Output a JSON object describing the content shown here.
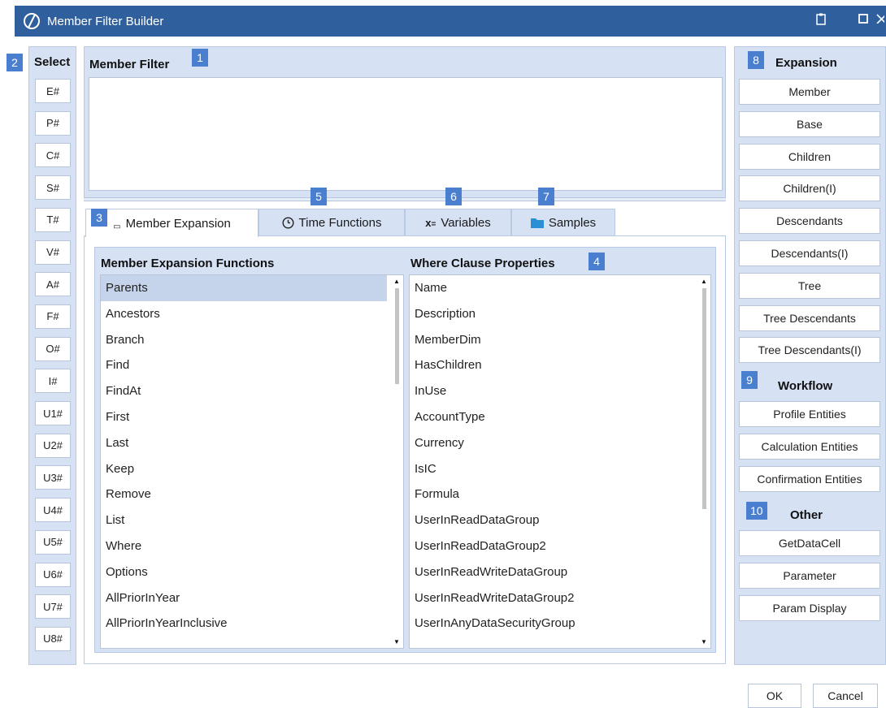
{
  "window": {
    "title": "Member Filter Builder"
  },
  "select": {
    "heading": "Select",
    "badge": "2",
    "buttons": [
      "E#",
      "P#",
      "C#",
      "S#",
      "T#",
      "V#",
      "A#",
      "F#",
      "O#",
      "I#",
      "U1#",
      "U2#",
      "U3#",
      "U4#",
      "U5#",
      "U6#",
      "U7#",
      "U8#"
    ]
  },
  "member_filter": {
    "heading": "Member Filter",
    "badge": "1",
    "value": ""
  },
  "tabs": [
    {
      "label": "Member Expansion",
      "badge": "3",
      "icon": "member-expansion-icon"
    },
    {
      "label": "Time Functions",
      "badge": "5",
      "icon": "clock-icon"
    },
    {
      "label": "Variables",
      "badge": "6",
      "icon": "variable-icon"
    },
    {
      "label": "Samples",
      "badge": "7",
      "icon": "folder-icon"
    }
  ],
  "functions": {
    "heading": "Member Expansion Functions",
    "selected": "Parents",
    "items": [
      "Parents",
      "Ancestors",
      "Branch",
      "Find",
      "FindAt",
      "First",
      "Last",
      "Keep",
      "Remove",
      "List",
      "Where",
      "Options",
      "AllPriorInYear",
      "AllPriorInYearInclusive"
    ]
  },
  "where_clause": {
    "heading": "Where Clause Properties",
    "badge": "4",
    "items": [
      "Name",
      "Description",
      "MemberDim",
      "HasChildren",
      "InUse",
      "AccountType",
      "Currency",
      "IsIC",
      "Formula",
      "UserInReadDataGroup",
      "UserInReadDataGroup2",
      "UserInReadWriteDataGroup",
      "UserInReadWriteDataGroup2",
      "UserInAnyDataSecurityGroup"
    ]
  },
  "expansion": {
    "heading": "Expansion",
    "badge": "8",
    "buttons": [
      "Member",
      "Base",
      "Children",
      "Children(I)",
      "Descendants",
      "Descendants(I)",
      "Tree",
      "Tree Descendants",
      "Tree Descendants(I)"
    ]
  },
  "workflow": {
    "heading": "Workflow",
    "badge": "9",
    "buttons": [
      "Profile Entities",
      "Calculation Entities",
      "Confirmation Entities"
    ]
  },
  "other": {
    "heading": "Other",
    "badge": "10",
    "buttons": [
      "GetDataCell",
      "Parameter",
      "Param Display"
    ]
  },
  "dialog": {
    "ok": "OK",
    "cancel": "Cancel"
  },
  "colors": {
    "titlebar": "#2f5f9c",
    "panel": "#d6e2f4",
    "badge": "#4a7fd0",
    "selected": "#c5d4ea"
  }
}
